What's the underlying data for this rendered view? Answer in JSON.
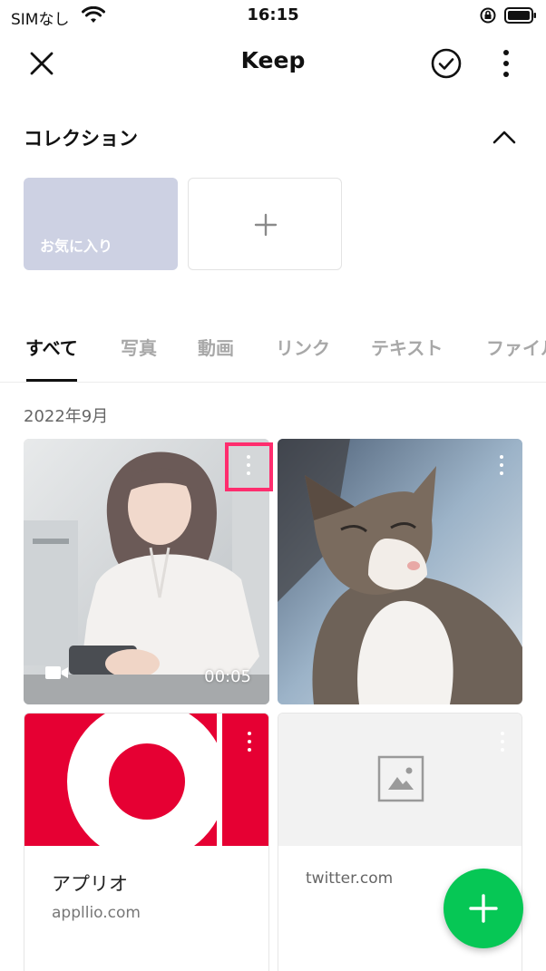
{
  "status_bar": {
    "carrier": "SIMなし",
    "time": "16:15",
    "icons": [
      "wifi-icon",
      "rotation-lock-icon",
      "battery-icon"
    ]
  },
  "header": {
    "title": "Keep",
    "icons": [
      "close-icon",
      "check-circle-icon",
      "more-vertical-icon"
    ]
  },
  "collection": {
    "title": "コレクション",
    "toggle_icon": "chevron-up-icon",
    "items": [
      {
        "label": "お気に入り"
      }
    ],
    "add_icon": "plus-icon"
  },
  "tabs": [
    {
      "label": "すべて",
      "active": true
    },
    {
      "label": "写真",
      "active": false
    },
    {
      "label": "動画",
      "active": false
    },
    {
      "label": "リンク",
      "active": false
    },
    {
      "label": "テキスト",
      "active": false
    },
    {
      "label": "ファイル",
      "active": false
    }
  ],
  "date_group": "2022年9月",
  "items": [
    {
      "type": "video",
      "duration": "00:05",
      "icon": "video-camera-icon"
    },
    {
      "type": "photo"
    },
    {
      "type": "link",
      "title": "アプリオ",
      "domain": "appllio.com"
    },
    {
      "type": "link",
      "domain": "twitter.com",
      "thumbnail_icon": "image-placeholder-icon"
    }
  ],
  "fab": {
    "icon": "plus-icon"
  },
  "colors": {
    "accent_green": "#06c755",
    "highlight": "#ff2d6e",
    "favorite_bg": "#cdd1e3",
    "applio_red": "#e60033"
  }
}
